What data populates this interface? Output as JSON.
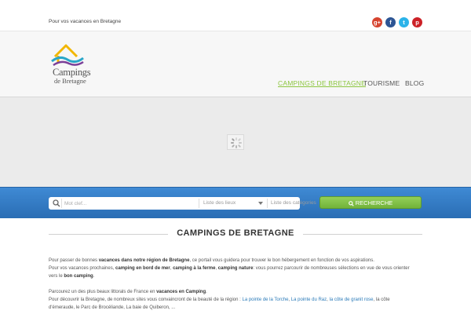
{
  "topbar": {
    "tagline": "Pour vos vacances en Bretagne",
    "social": [
      {
        "icon": "google-plus-icon",
        "glyph": "g+",
        "color": "#d6442f"
      },
      {
        "icon": "facebook-icon",
        "glyph": "f",
        "color": "#2d5594"
      },
      {
        "icon": "twitter-icon",
        "glyph": "t",
        "color": "#2bb3e9"
      },
      {
        "icon": "pinterest-icon",
        "glyph": "p",
        "color": "#cc2127"
      }
    ]
  },
  "header": {
    "logo": {
      "line1": "Campings",
      "line2": "de Bretagne",
      "icon": "house-waves-logo"
    },
    "nav": [
      {
        "label": "CAMPINGS DE BRETAGNE",
        "active": true
      },
      {
        "label": "TOURISME",
        "active": false
      },
      {
        "label": "BLOG",
        "active": false
      }
    ],
    "active_color": "#8cc63f"
  },
  "slider": {
    "state": "loading",
    "icon": "spinner-icon"
  },
  "search": {
    "keyword_placeholder": "Mot clef...",
    "location_select": "Liste des lieux",
    "category_select": "Liste des catégories",
    "button_label": "RECHERCHE",
    "button_color": "#7dbd45",
    "bar_color": "#3179c4"
  },
  "content": {
    "title": "CAMPINGS DE BRETAGNE",
    "p1": {
      "a": "Pour passer de bonnes ",
      "b": "vacances dans notre région de Bretagne",
      "c": ", ce portail vous guidera pour trouver le bon hébergement en fonction de vos aspirations."
    },
    "p2": {
      "a": "Pour vos vacances prochaines, ",
      "b": "camping en bord de mer",
      "c": ", ",
      "d": "camping à la ferme",
      "e": ", ",
      "f": "camping nature",
      "g": ": vous pourrez parcourir de nombreuses sélections en vue de vous orienter"
    },
    "p3": {
      "a": "vers le ",
      "b": "bon camping",
      "c": "."
    },
    "p4": {
      "a": "Parcourez un des plus beaux littorals de France en ",
      "b": "vacances en Camping",
      "c": "."
    },
    "p5": {
      "a": "Pour découvrir la Bretagne, de nombreux sites vous convaincront de la beauté de la région : ",
      "link1": "La pointe de la Torche",
      "sep1": ", ",
      "link2": "La pointe du Raz",
      "sep2": ", ",
      "link3": "la côte de granit rose",
      "c": ", la côte"
    },
    "p6": {
      "a": "d'émeraude, le Parc de Brocéliande, La baie de Quiberon, ..."
    }
  }
}
